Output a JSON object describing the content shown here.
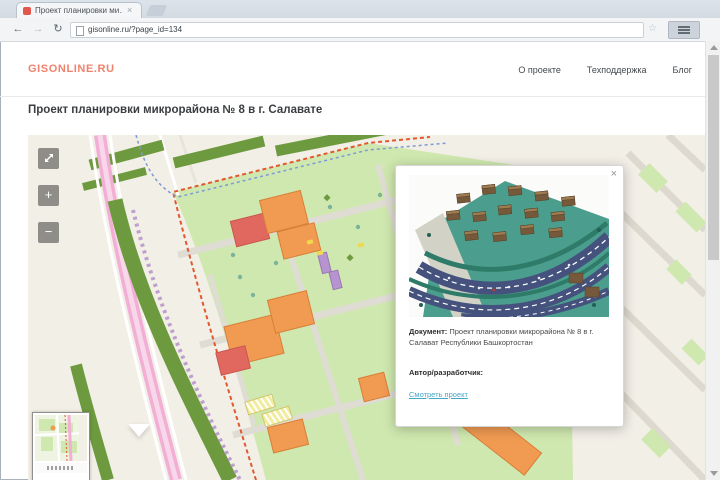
{
  "browser": {
    "tab": {
      "title": "Проект планировки ми…",
      "close_icon": "×"
    },
    "toolbar": {
      "back_icon": "←",
      "forward_icon": "→",
      "refresh_icon": "↻",
      "url": "gisonline.ru/?page_id=134",
      "star_icon": "☆"
    }
  },
  "header": {
    "logo": "GISONLINE.RU",
    "nav": [
      {
        "label": "О проекте"
      },
      {
        "label": "Техподдержка"
      },
      {
        "label": "Блог"
      }
    ]
  },
  "page": {
    "title": "Проект планировки микрорайона № 8 в г. Салавате"
  },
  "map": {
    "controls": {
      "zoom_in": "+",
      "zoom_out": "−"
    }
  },
  "popup": {
    "close_icon": "×",
    "document_label": "Документ:",
    "document_value": "Проект планировки микрорайона № 8 в г. Салават Республики Башкортостан",
    "author_label": "Автор/разработчик:",
    "link_label": "Смотреть проект"
  },
  "colors": {
    "logo_orange": "#f0826d",
    "link_blue": "#46a8c9",
    "map_beige": "#f2efe7",
    "map_green_light": "#cfe8af",
    "map_green_dark": "#6d9a3e",
    "map_pink_road": "#f2aed4",
    "building_orange": "#f09a52",
    "building_red": "#e0685f",
    "boundary_red": "#e1582f"
  }
}
